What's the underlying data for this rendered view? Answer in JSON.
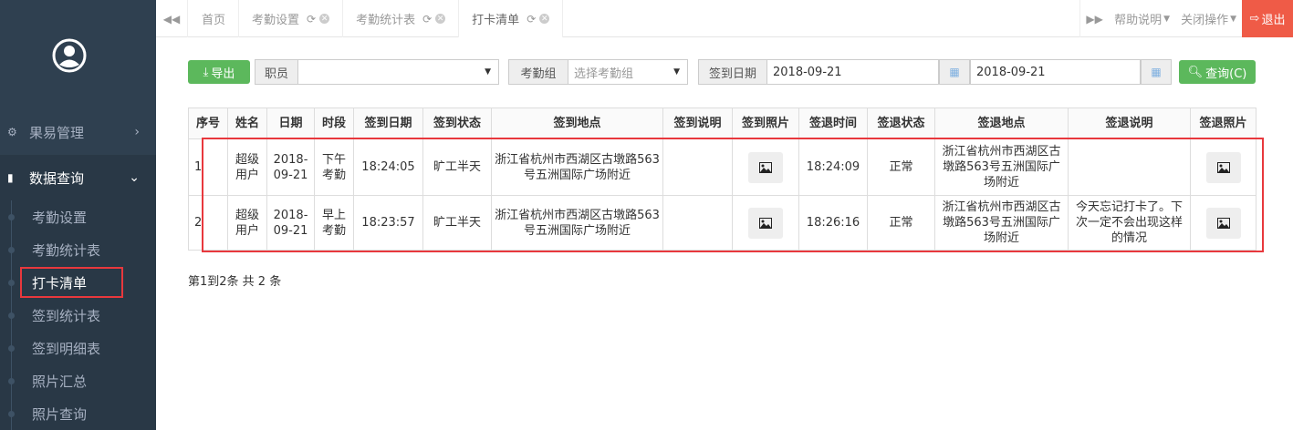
{
  "sidebar": {
    "menu": [
      {
        "label": "果易管理",
        "icon": "cogs-icon"
      },
      {
        "label": "数据查询",
        "icon": "bar-chart-icon"
      }
    ],
    "submenu": [
      "考勤设置",
      "考勤统计表",
      "打卡清单",
      "签到统计表",
      "签到明细表",
      "照片汇总",
      "照片查询"
    ]
  },
  "tabbar": {
    "tabs": [
      {
        "label": "首页"
      },
      {
        "label": "考勤设置"
      },
      {
        "label": "考勤统计表"
      },
      {
        "label": "打卡清单"
      }
    ],
    "help": "帮助说明",
    "close_ops": "关闭操作",
    "logout": "退出"
  },
  "toolbar": {
    "export": "导出",
    "employee_label": "职员",
    "employee_value": "",
    "group_label": "考勤组",
    "group_placeholder": "选择考勤组",
    "date_label": "签到日期",
    "date_from": "2018-09-21",
    "date_to": "2018-09-21",
    "query": "查询(C)"
  },
  "table": {
    "headers": [
      "序号",
      "姓名",
      "日期",
      "时段",
      "签到日期",
      "签到状态",
      "签到地点",
      "签到说明",
      "签到照片",
      "签退时间",
      "签退状态",
      "签退地点",
      "签退说明",
      "签退照片"
    ],
    "rows": [
      {
        "no": "1",
        "name": "超级用户",
        "date": "2018-09-21",
        "period": "下午考勤",
        "in_time": "18:24:05",
        "in_status": "旷工半天",
        "in_place": "浙江省杭州市西湖区古墩路563号五洲国际广场附近",
        "in_note": "",
        "out_time": "18:24:09",
        "out_status": "正常",
        "out_place": "浙江省杭州市西湖区古墩路563号五洲国际广场附近",
        "out_note": ""
      },
      {
        "no": "2",
        "name": "超级用户",
        "date": "2018-09-21",
        "period": "早上考勤",
        "in_time": "18:23:57",
        "in_status": "旷工半天",
        "in_place": "浙江省杭州市西湖区古墩路563号五洲国际广场附近",
        "in_note": "",
        "out_time": "18:26:16",
        "out_status": "正常",
        "out_place": "浙江省杭州市西湖区古墩路563号五洲国际广场附近",
        "out_note": "今天忘记打卡了。下次一定不会出现这样的情况"
      }
    ]
  },
  "footer": "第1到2条 共 2 条",
  "colors": {
    "sidebar_bg": "#2f4050",
    "green": "#5cb85c",
    "logout": "#ef5b47",
    "highlight": "#e8383d"
  }
}
